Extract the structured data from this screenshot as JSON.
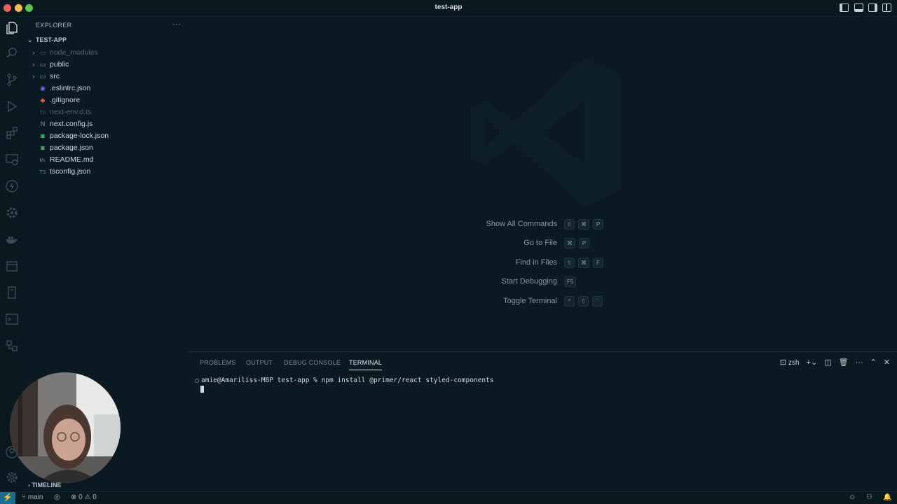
{
  "window": {
    "title": "test-app"
  },
  "sidebar": {
    "title": "EXPLORER",
    "root": "TEST-APP",
    "items": [
      {
        "label": "node_modules",
        "kind": "folder",
        "icon": "folder-icon",
        "dim": true
      },
      {
        "label": "public",
        "kind": "folder",
        "icon": "folder-icon",
        "dim": false
      },
      {
        "label": "src",
        "kind": "folder",
        "icon": "folder-icon",
        "dim": false
      },
      {
        "label": ".eslintrc.json",
        "kind": "file",
        "icon": "eslint-icon",
        "dim": false
      },
      {
        "label": ".gitignore",
        "kind": "file",
        "icon": "git-icon",
        "dim": false
      },
      {
        "label": "next-env.d.ts",
        "kind": "file",
        "icon": "typescript-icon",
        "dim": true
      },
      {
        "label": "next.config.js",
        "kind": "file",
        "icon": "next-icon",
        "dim": false
      },
      {
        "label": "package-lock.json",
        "kind": "file",
        "icon": "npm-icon",
        "dim": false
      },
      {
        "label": "package.json",
        "kind": "file",
        "icon": "npm-icon",
        "dim": false
      },
      {
        "label": "README.md",
        "kind": "file",
        "icon": "markdown-icon",
        "dim": false
      },
      {
        "label": "tsconfig.json",
        "kind": "file",
        "icon": "typescript-icon",
        "dim": false
      }
    ],
    "icon_glyphs": {
      "eslint": "◉",
      "git": "◆",
      "ts": "TS",
      "next": "N",
      "npm": "◙",
      "md": "M↓"
    },
    "timeline": "TIMELINE"
  },
  "editor": {
    "shortcuts": [
      {
        "label": "Show All Commands",
        "keys": [
          "⇧",
          "⌘",
          "P"
        ]
      },
      {
        "label": "Go to File",
        "keys": [
          "⌘",
          "P"
        ]
      },
      {
        "label": "Find in Files",
        "keys": [
          "⇧",
          "⌘",
          "F"
        ]
      },
      {
        "label": "Start Debugging",
        "keys": [
          "F5"
        ]
      },
      {
        "label": "Toggle Terminal",
        "keys": [
          "^",
          "⇧",
          "`"
        ]
      }
    ]
  },
  "panel": {
    "tabs": {
      "problems": "PROBLEMS",
      "output": "OUTPUT",
      "debug": "DEBUG CONSOLE",
      "terminal": "TERMINAL"
    },
    "shell": "zsh",
    "terminal_line": "amie@Amariliss-MBP test-app % npm install @primer/react styled-components"
  },
  "statusbar": {
    "branch": "main",
    "errors": "0",
    "warnings": "0"
  },
  "colors": {
    "background": "#0b1a22",
    "accent": "#1b6f8e"
  }
}
